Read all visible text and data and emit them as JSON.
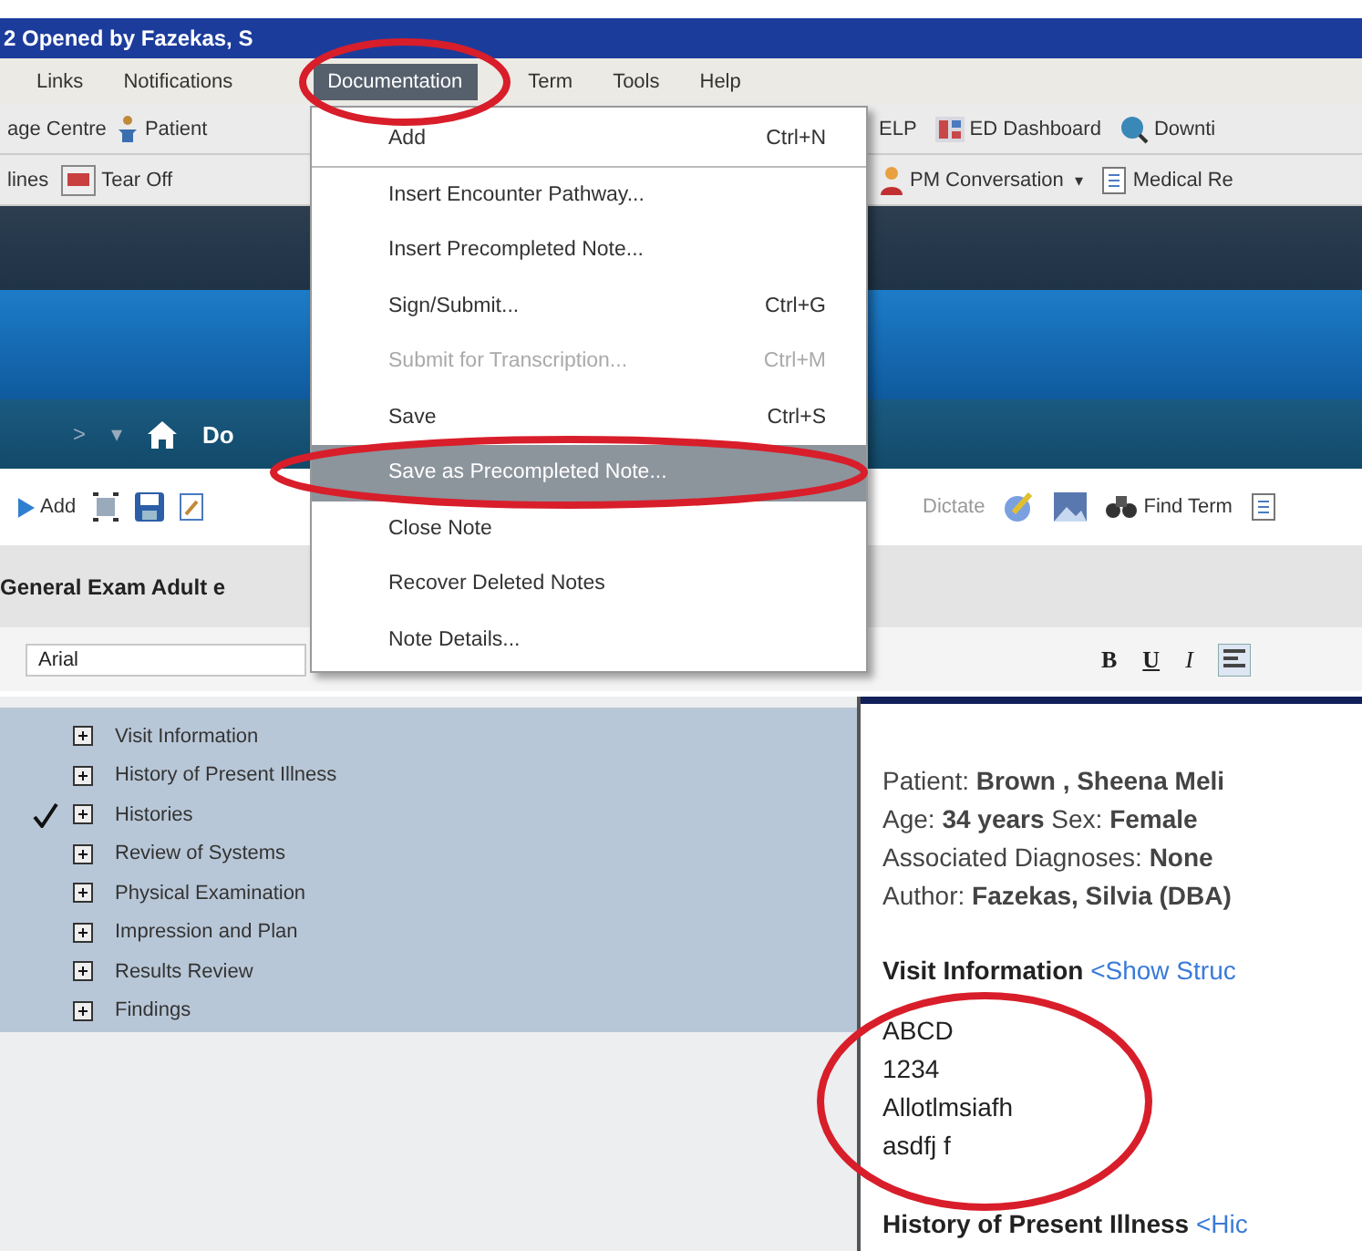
{
  "title_bar": {
    "title": "2 Opened by Fazekas, S"
  },
  "menu_bar": [
    {
      "label": "Links",
      "selected": false
    },
    {
      "label": "Notifications",
      "selected": false
    },
    {
      "label": "Documentation",
      "selected": true
    },
    {
      "label": "Term",
      "selected": false
    },
    {
      "label": "Tools",
      "selected": false
    },
    {
      "label": "Help",
      "selected": false
    }
  ],
  "toolbar_1": {
    "left": [
      {
        "label": "age Centre",
        "kind": "text"
      },
      {
        "label": "Patient",
        "kind": "person"
      }
    ],
    "right": [
      {
        "label": "ELP",
        "kind": "text"
      },
      {
        "label": "ED Dashboard",
        "kind": "dashboard"
      },
      {
        "label": "Downti",
        "kind": "globe"
      }
    ]
  },
  "toolbar_2": {
    "left": [
      {
        "label": "lines",
        "kind": "text"
      },
      {
        "label": "Tear Off",
        "kind": "tear"
      }
    ],
    "right": [
      {
        "label": "PM Conversation",
        "kind": "person-menu",
        "caret": "▾"
      },
      {
        "label": "Medical Re",
        "kind": "doc"
      }
    ]
  },
  "breadcrumb": {
    "nav": [
      ">",
      "▾"
    ],
    "label": "Do"
  },
  "note_toolbar": {
    "left": [
      {
        "label": "Add",
        "kind": "add"
      },
      {
        "kind": "select"
      },
      {
        "kind": "save"
      },
      {
        "kind": "edit"
      }
    ],
    "right": [
      {
        "label": "Dictate",
        "kind": "disabled"
      },
      {
        "kind": "pen"
      },
      {
        "kind": "image"
      },
      {
        "label": "Find Term",
        "kind": "binoculars"
      },
      {
        "kind": "doc"
      }
    ]
  },
  "note_title": "General Exam Adult e",
  "format_toolbar": {
    "font": "Arial",
    "buttons": [
      {
        "label": "B",
        "kind": "bold"
      },
      {
        "label": "U",
        "kind": "underline"
      },
      {
        "label": "I",
        "kind": "italic"
      }
    ]
  },
  "documentation_menu": [
    {
      "label": "Add",
      "shortcut": "Ctrl+N",
      "disabled": false,
      "selected": false,
      "separator_after": true
    },
    {
      "label": "Insert Encounter Pathway...",
      "disabled": false,
      "selected": false,
      "separator_after": false
    },
    {
      "label": "Insert Precompleted Note...",
      "disabled": false,
      "selected": false,
      "separator_after": false
    },
    {
      "label": "Sign/Submit...",
      "shortcut": "Ctrl+G",
      "disabled": false,
      "selected": false,
      "separator_after": false
    },
    {
      "label": "Submit for Transcription...",
      "shortcut": "Ctrl+M",
      "disabled": true,
      "selected": false,
      "separator_after": false
    },
    {
      "label": "Save",
      "shortcut": "Ctrl+S",
      "disabled": false,
      "selected": false,
      "separator_after": false
    },
    {
      "label": "Save as Precompleted Note...",
      "disabled": false,
      "selected": true,
      "separator_after": false
    },
    {
      "label": "Close Note",
      "disabled": false,
      "selected": false,
      "separator_after": false
    },
    {
      "label": "Recover Deleted Notes",
      "disabled": false,
      "selected": false,
      "separator_after": false
    },
    {
      "label": "Note Details...",
      "disabled": false,
      "selected": false,
      "separator_after": false
    }
  ],
  "sections": [
    {
      "label": "Visit Information",
      "checked": false
    },
    {
      "label": "History of Present Illness",
      "checked": false
    },
    {
      "label": "Histories",
      "checked": true
    },
    {
      "label": "Review of Systems",
      "checked": false
    },
    {
      "label": "Physical Examination",
      "checked": false
    },
    {
      "label": "Impression and Plan",
      "checked": false
    },
    {
      "label": "Results Review",
      "checked": false
    },
    {
      "label": "Findings",
      "checked": false
    }
  ],
  "note": {
    "header": [
      "Patient:  **Brown , Sheena Meli**",
      "Age:  **34 years**    Sex: **Female**",
      "Associated Diagnoses:  **None**",
      "Author:  **Fazekas, Silvia (DBA)**"
    ],
    "visit_heading": "Visit Information",
    "visit_link": "<Show Struc",
    "visit_lines": [
      "ABCD",
      "1234",
      "Allotlmsiafh",
      "asdfj f"
    ],
    "hpi_heading": "History of Present Illness",
    "hpi_link": "<Hic"
  }
}
